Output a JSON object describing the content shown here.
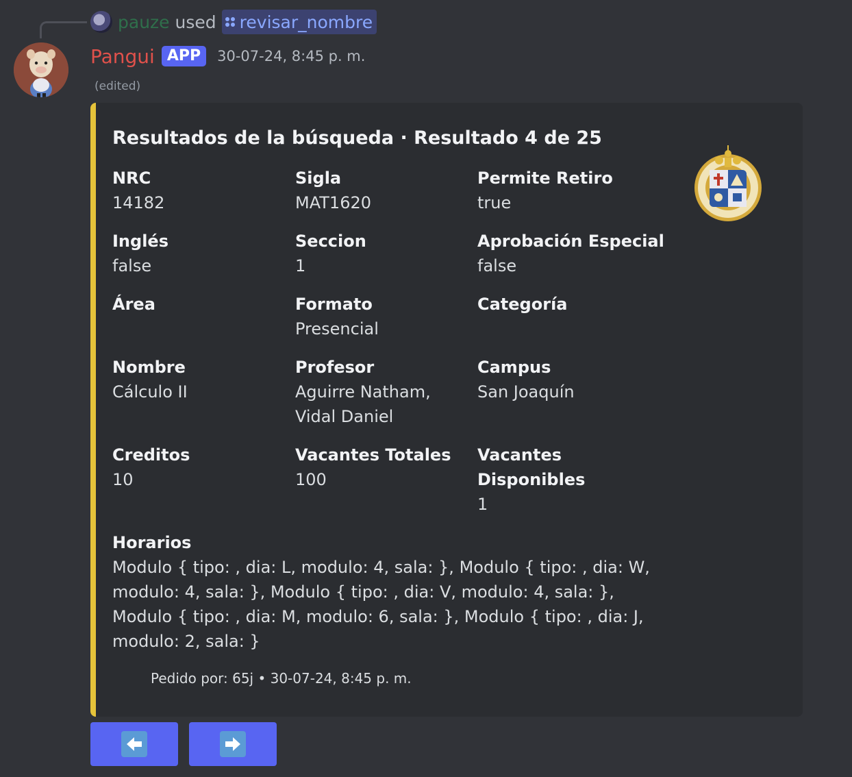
{
  "reply": {
    "user": "pauze",
    "used_text": "used",
    "command": "revisar_nombre"
  },
  "message": {
    "username": "Pangui",
    "badge": "APP",
    "timestamp": "30-07-24, 8:45 p. m.",
    "edited": "(edited)"
  },
  "embed": {
    "accent_color": "#e6c33a",
    "title": "Resultados de la búsqueda · Resultado 4 de 25",
    "thumbnail_icon": "universidad-catolica-seal",
    "fields": [
      {
        "name": "NRC",
        "value": "14182"
      },
      {
        "name": "Sigla",
        "value": "MAT1620"
      },
      {
        "name": "Permite Retiro",
        "value": "true"
      },
      {
        "name": "Inglés",
        "value": "false"
      },
      {
        "name": "Seccion",
        "value": "1"
      },
      {
        "name": "Aprobación Especial",
        "value": "false"
      },
      {
        "name": "Área",
        "value": ""
      },
      {
        "name": "Formato",
        "value": "Presencial"
      },
      {
        "name": "Categoría",
        "value": ""
      },
      {
        "name": "Nombre",
        "value": "Cálculo II"
      },
      {
        "name": "Profesor",
        "value": "Aguirre Natham, Vidal Daniel"
      },
      {
        "name": "Campus",
        "value": "San Joaquín"
      },
      {
        "name": "Creditos",
        "value": "10"
      },
      {
        "name": "Vacantes Totales",
        "value": "100"
      },
      {
        "name": "Vacantes Disponibles",
        "value": "1"
      },
      {
        "name": "Horarios",
        "value": "Modulo { tipo: , dia: L, modulo: 4, sala: }, Modulo { tipo: , dia: W, modulo: 4, sala: }, Modulo { tipo: , dia: V, modulo: 4, sala: }, Modulo { tipo: , dia: M, modulo: 6, sala: }, Modulo { tipo: , dia: J, modulo: 2, sala: }"
      }
    ],
    "footer": "Pedido por: 65j • 30-07-24, 8:45 p. m."
  },
  "buttons": [
    {
      "icon": "left-arrow-icon"
    },
    {
      "icon": "right-arrow-icon"
    }
  ],
  "colors": {
    "background": "#313338",
    "embed_bg": "#2b2d31",
    "username": "#e0514b",
    "badge": "#5865f2",
    "button": "#5865f2",
    "command_pill": "#3c4270"
  }
}
